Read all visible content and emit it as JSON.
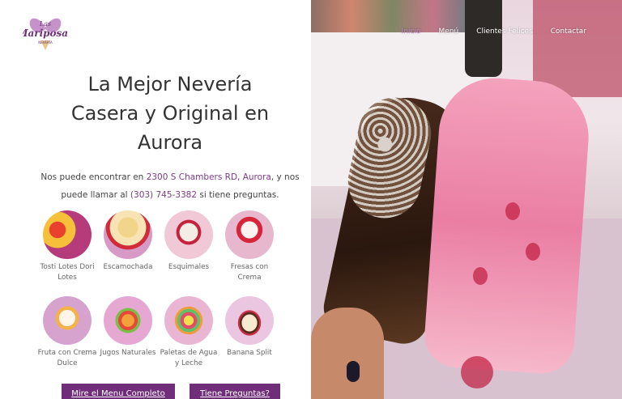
{
  "logo": {
    "text": "Las Mariposas",
    "sub": "NEVERÍA"
  },
  "nav": {
    "items": [
      "Inicio",
      "Menú",
      "Clientes Felices",
      "Contactar"
    ]
  },
  "headline": {
    "line1": "La Mejor Nevería",
    "line2": "Casera y Original en",
    "line3": "Aurora"
  },
  "info": {
    "prefix": "Nos puede encontrar en ",
    "address": "2300 S Chambers RD, Aurora",
    "middle": ", y nos puede llamar al ",
    "phone": "(303) 745-3382",
    "suffix": " si tiene preguntas."
  },
  "products": [
    {
      "label": "Tosti Lotes Dori Lotes"
    },
    {
      "label": "Escamochada"
    },
    {
      "label": "Esquimales"
    },
    {
      "label": "Fresas con Crema"
    },
    {
      "label": "Fruta con Crema Dulce"
    },
    {
      "label": "Jugos Naturales"
    },
    {
      "label": "Paletas de Agua y Leche"
    },
    {
      "label": "Banana Split"
    }
  ],
  "buttons": {
    "menu": "Mire el Menu Completo",
    "questions": "Tiene Preguntas?"
  },
  "colors": {
    "brand": "#6f2d7a",
    "link": "#7d3a86",
    "active_nav": "#c487c7"
  }
}
